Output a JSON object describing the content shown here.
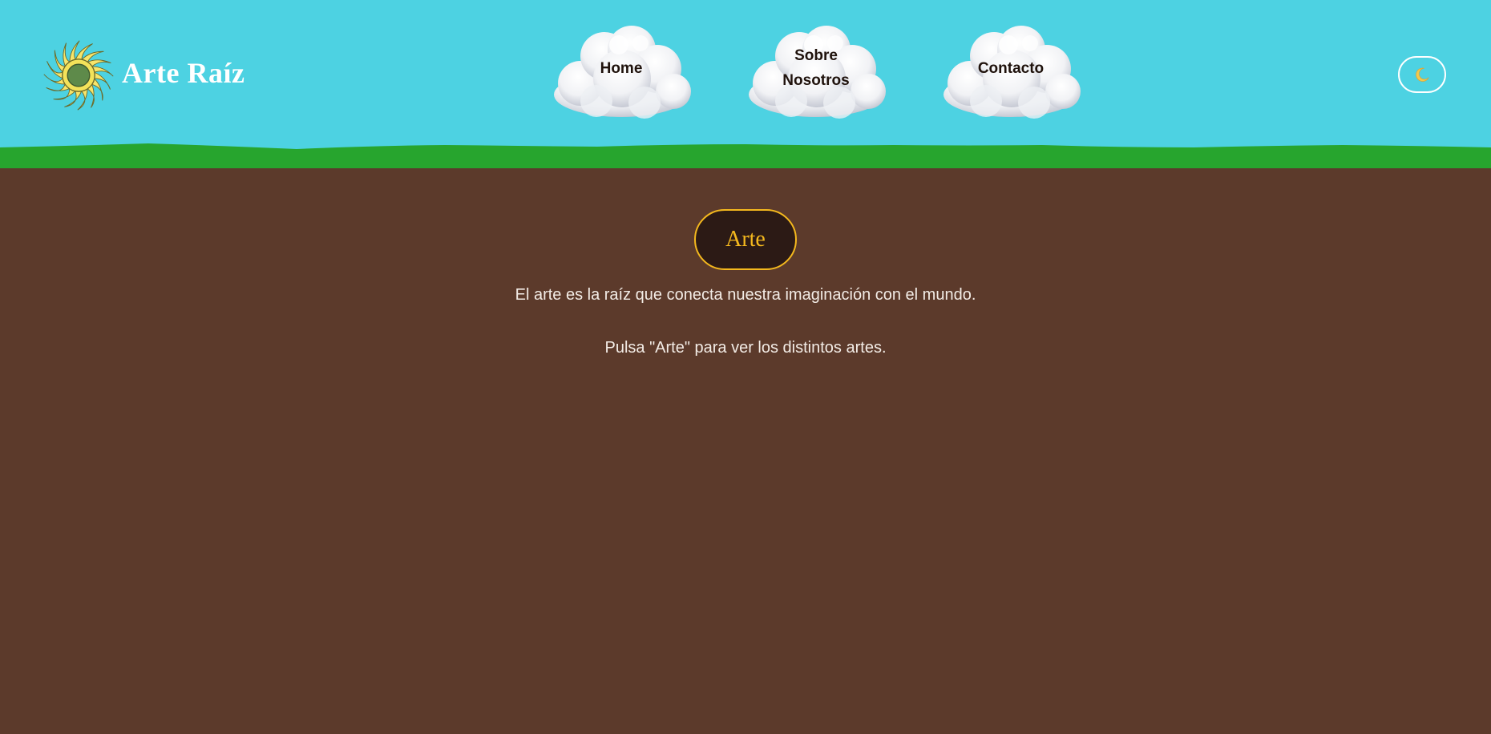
{
  "header": {
    "brand": {
      "name": "Arte Raíz",
      "icon": "sun-icon"
    },
    "nav": [
      {
        "label": "Home"
      },
      {
        "label": "Sobre Nosotros"
      },
      {
        "label": "Contacto"
      }
    ],
    "theme_toggle": {
      "icon": "moon-icon"
    }
  },
  "main": {
    "arte_button": "Arte",
    "intro": "El arte es la raíz que conecta nuestra imaginación con el mundo.",
    "hint": "Pulsa \"Arte\" para ver los distintos artes."
  },
  "colors": {
    "sky": "#4dd2e2",
    "grass": "#27a52e",
    "soil": "#5c3a2b",
    "accent": "#f4b81e",
    "button_bg": "#2c1a15"
  }
}
